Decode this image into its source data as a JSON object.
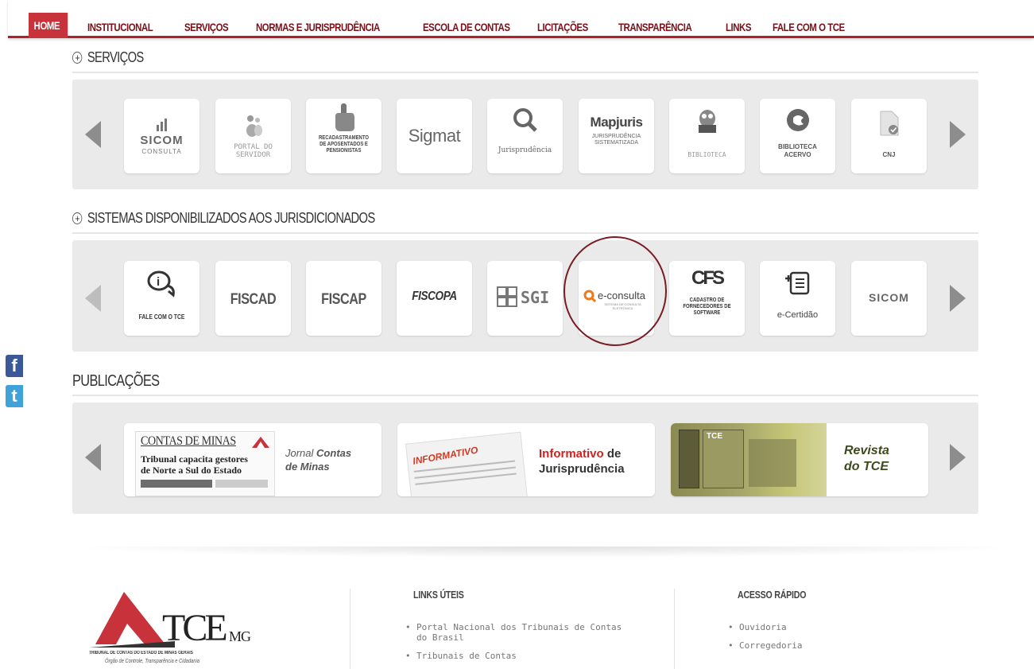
{
  "nav": {
    "items": [
      "HOME",
      "INSTITUCIONAL",
      "SERVIÇOS",
      "NORMAS E JURISPRUDÊNCIA",
      "ESCOLA DE CONTAS",
      "LICITAÇÕES",
      "TRANSPARÊNCIA",
      "LINKS",
      "FALE COM O TCE"
    ],
    "active": "HOME"
  },
  "servicos": {
    "title": "SERVIÇOS",
    "tiles": [
      {
        "name": "sicom-consulta",
        "main": "SICOM",
        "sub": "CONSULTA",
        "icon": "bar-chart-icon"
      },
      {
        "name": "portal-do-servidor",
        "main": "PORTAL DO",
        "sub": "SERVIDOR",
        "icon": "people-icon"
      },
      {
        "name": "recadastramento",
        "main": "RECADASTRAMENTO",
        "sub": "DE APOSENTADOS E PENSIONISTAS",
        "icon": "hand-pointer-icon"
      },
      {
        "name": "sigmat",
        "main": "Sigmat",
        "sub": "",
        "icon": "sigmat-logo-icon"
      },
      {
        "name": "jurisprudencia",
        "main": "Jurisprudência",
        "sub": "",
        "icon": "magnifier-icon"
      },
      {
        "name": "mapjuris",
        "main": "Mapjuris",
        "sub": "JURISPRUDÊNCIA SISTEMATIZADA",
        "icon": "mapjuris-logo-icon"
      },
      {
        "name": "biblioteca",
        "main": "BIBLIOTECA",
        "sub": "",
        "icon": "owl-book-icon"
      },
      {
        "name": "biblioteca-acervo",
        "main": "BIBLIOTECA",
        "sub": "ACERVO",
        "icon": "acervo-logo-icon"
      },
      {
        "name": "cnj",
        "main": "CNJ",
        "sub": "",
        "icon": "document-check-icon"
      }
    ]
  },
  "sistemas": {
    "title": "SISTEMAS DISPONIBILIZADOS AOS JURISDICIONADOS",
    "tiles": [
      {
        "name": "fale-com-o-tce",
        "main": "FALE COM O TCE",
        "icon": "speech-info-icon"
      },
      {
        "name": "fiscad",
        "main": "FISCAD",
        "icon": ""
      },
      {
        "name": "fiscap",
        "main": "FISCAP",
        "icon": ""
      },
      {
        "name": "fiscopa",
        "main": "FISCOPA",
        "icon": ""
      },
      {
        "name": "sgi",
        "main": "SGI",
        "icon": "grid-logo-icon"
      },
      {
        "name": "e-consulta",
        "main": "e-consulta",
        "sub": "SISTEMA DE CONSULTA ELETRÔNICA",
        "icon": "magnifier-orange-icon"
      },
      {
        "name": "cadastro-fornecedores",
        "main": "CFS",
        "sub": "CADASTRO DE FORNECEDORES DE SOFTWARE",
        "icon": ""
      },
      {
        "name": "e-certidao",
        "main": "e-Certidão",
        "icon": "document-list-icon"
      },
      {
        "name": "sicom",
        "main": "SICOM",
        "icon": ""
      }
    ]
  },
  "publicacoes": {
    "title": "PUBLICAÇÕES",
    "jornal": {
      "masthead": "CONTAS DE MINAS",
      "headline1": "Tribunal capacita gestores",
      "headline2": "de Norte a Sul do Estado",
      "label1": "Jornal",
      "label2": "Contas",
      "label3": "de Minas"
    },
    "informativo": {
      "stamp": "INFORMATIVO",
      "label1": "Informativo",
      "label2": "de",
      "label3": "Jurisprudência"
    },
    "revista": {
      "cover": "TCE",
      "label1": "Revista",
      "label2": "do TCE"
    }
  },
  "social": {
    "facebook": "f",
    "twitter": "t"
  },
  "footer": {
    "logo": {
      "brand": "TCE",
      "state": "MG",
      "line1": "TRIBUNAL DE CONTAS DO ESTADO DE MINAS GERAIS",
      "line2": "Órgão de Controle, Transparência e Cidadania"
    },
    "links_uteis": {
      "title": "LINKS ÚTEIS",
      "items": [
        "Portal Nacional dos Tribunais de Contas do Brasil",
        "Tribunais de Contas"
      ]
    },
    "acesso_rapido": {
      "title": "ACESSO RÁPIDO",
      "items": [
        "Ouvidoria",
        "Corregedoria"
      ]
    }
  },
  "colors": {
    "brand_red": "#b0202a",
    "nav_text": "#7a1018",
    "highlight_circle": "#7a1a22",
    "econsulta_orange": "#f07a1a"
  }
}
